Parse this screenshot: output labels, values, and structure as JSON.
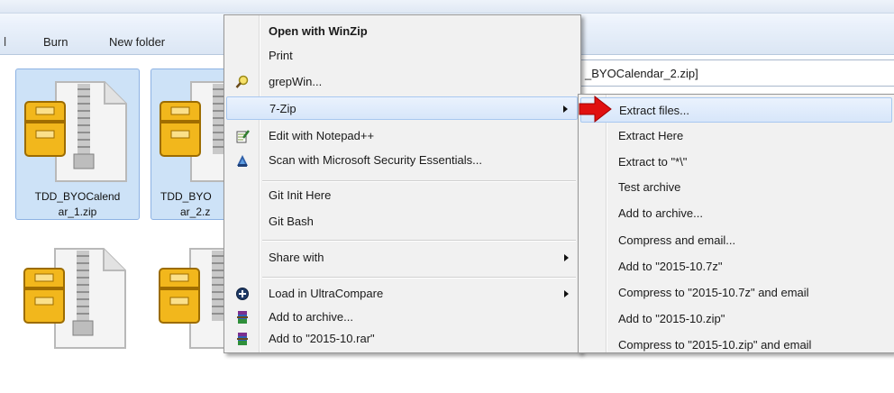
{
  "toolbar": {
    "partial_label": "l",
    "burn_label": "Burn",
    "new_folder_label": "New folder"
  },
  "address": {
    "path_text": "_BYOCalendar_2.zip]"
  },
  "files": [
    {
      "name_line1": "TDD_BYOCalend",
      "name_line2": "ar_1.zip",
      "selected": true
    },
    {
      "name_line1": "TDD_BYO",
      "name_line2": "ar_2.z",
      "selected": true
    },
    {
      "name_line1": "",
      "name_line2": "",
      "selected": false
    },
    {
      "name_line1": "",
      "name_line2": "",
      "selected": false
    }
  ],
  "context_menu": {
    "items": [
      {
        "label": "Open with WinZip",
        "icon": "",
        "bold": true,
        "submenu": false
      },
      {
        "label": "Print",
        "icon": "",
        "bold": false,
        "submenu": false
      },
      {
        "label": "grepWin...",
        "icon": "magnifier-icon",
        "bold": false,
        "submenu": false
      },
      {
        "label": "7-Zip",
        "icon": "",
        "bold": false,
        "submenu": true,
        "highlighted": true
      },
      {
        "label": "Edit with Notepad++",
        "icon": "notepadpp-icon",
        "bold": false,
        "submenu": false
      },
      {
        "label": "Scan with Microsoft Security Essentials...",
        "icon": "mse-shield-icon",
        "bold": false,
        "submenu": false
      },
      {
        "label": "Git Init Here",
        "icon": "",
        "bold": false,
        "submenu": false
      },
      {
        "label": "Git Bash",
        "icon": "",
        "bold": false,
        "submenu": false
      },
      {
        "label": "Share with",
        "icon": "",
        "bold": false,
        "submenu": true
      },
      {
        "label": "Load in UltraCompare",
        "icon": "ultracompare-icon",
        "bold": false,
        "submenu": true
      },
      {
        "label": "Add to archive...",
        "icon": "winrar-icon",
        "bold": false,
        "submenu": false
      },
      {
        "label": "Add to \"2015-10.rar\"",
        "icon": "winrar-icon",
        "bold": false,
        "submenu": false
      }
    ]
  },
  "zip_submenu": {
    "items": [
      {
        "label": "Extract files...",
        "highlighted": true
      },
      {
        "label": "Extract Here"
      },
      {
        "label": "Extract to \"*\\\""
      },
      {
        "label": "Test archive"
      },
      {
        "label": "Add to archive..."
      },
      {
        "label": "Compress and email..."
      },
      {
        "label": "Add to \"2015-10.7z\""
      },
      {
        "label": "Compress to \"2015-10.7z\" and email"
      },
      {
        "label": "Add to \"2015-10.zip\""
      },
      {
        "label": "Compress to \"2015-10.zip\" and email"
      }
    ]
  },
  "colors": {
    "menu_background": "#f1f1f1",
    "highlight": "#d7e6fa",
    "selection": "#cde2f7",
    "pointer_arrow": "#e01010"
  }
}
